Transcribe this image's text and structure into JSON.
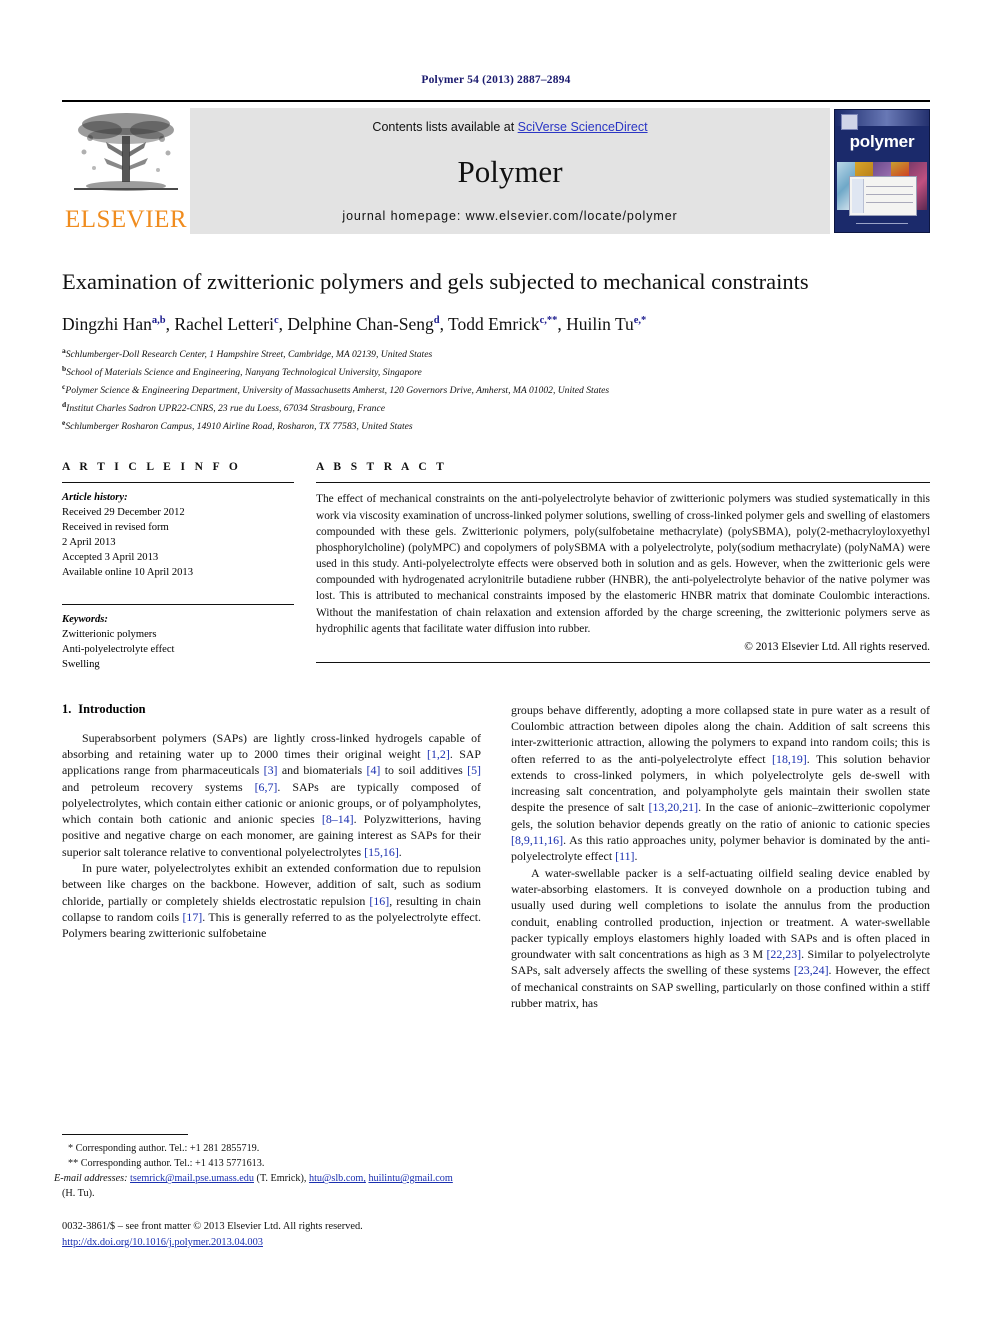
{
  "running_head": "Polymer 54 (2013) 2887–2894",
  "masthead": {
    "publisher_wordmark": "ELSEVIER",
    "contents_prefix": "Contents lists available at ",
    "contents_link": "SciVerse ScienceDirect",
    "journal_title": "Polymer",
    "homepage": "journal homepage: www.elsevier.com/locate/polymer",
    "cover_title": "polymer"
  },
  "article": {
    "title": "Examination of zwitterionic polymers and gels subjected to mechanical constraints",
    "authors_html": "Dingzhi Han<sup>a,b</sup>, Rachel Letteri<sup>c</sup>, Delphine Chan-Seng<sup>d</sup>, Todd Emrick<sup>c,**</sup>, Huilin Tu<sup>e,*</sup>",
    "affiliations": [
      {
        "marker": "a",
        "text": "Schlumberger-Doll Research Center, 1 Hampshire Street, Cambridge, MA 02139, United States"
      },
      {
        "marker": "b",
        "text": "School of Materials Science and Engineering, Nanyang Technological University, Singapore"
      },
      {
        "marker": "c",
        "text": "Polymer Science & Engineering Department, University of Massachusetts Amherst, 120 Governors Drive, Amherst, MA 01002, United States"
      },
      {
        "marker": "d",
        "text": "Institut Charles Sadron UPR22-CNRS, 23 rue du Loess, 67034 Strasbourg, France"
      },
      {
        "marker": "e",
        "text": "Schlumberger Rosharon Campus, 14910 Airline Road, Rosharon, TX 77583, United States"
      }
    ]
  },
  "article_info": {
    "heading": "A R T I C L E  I N F O",
    "history_label": "Article history:",
    "history_lines": [
      "Received 29 December 2012",
      "Received in revised form",
      "2 April 2013",
      "Accepted 3 April 2013",
      "Available online 10 April 2013"
    ],
    "keywords_label": "Keywords:",
    "keywords": [
      "Zwitterionic polymers",
      "Anti-polyelectrolyte effect",
      "Swelling"
    ]
  },
  "abstract": {
    "heading": "A B S T R A C T",
    "text": "The effect of mechanical constraints on the anti-polyelectrolyte behavior of zwitterionic polymers was studied systematically in this work via viscosity examination of uncross-linked polymer solutions, swelling of cross-linked polymer gels and swelling of elastomers compounded with these gels. Zwitterionic polymers, poly(sulfobetaine methacrylate) (polySBMA), poly(2-methacryloyloxyethyl phosphorylcholine) (polyMPC) and copolymers of polySBMA with a polyelectrolyte, poly(sodium methacrylate) (polyNaMA) were used in this study. Anti-polyelectrolyte effects were observed both in solution and as gels. However, when the zwitterionic gels were compounded with hydrogenated acrylonitrile butadiene rubber (HNBR), the anti-polyelectrolyte behavior of the native polymer was lost. This is attributed to mechanical constraints imposed by the elastomeric HNBR matrix that dominate Coulombic interactions. Without the manifestation of chain relaxation and extension afforded by the charge screening, the zwitterionic polymers serve as hydrophilic agents that facilitate water diffusion into rubber.",
    "copyright": "© 2013 Elsevier Ltd. All rights reserved."
  },
  "body": {
    "section_number": "1.",
    "section_title": "Introduction",
    "left_paragraphs_html": [
      "Superabsorbent polymers (SAPs) are lightly cross-linked hydrogels capable of absorbing and retaining water up to 2000 times their original weight <span class=\"ref\">[1,2]</span>. SAP applications range from pharmaceuticals <span class=\"ref\">[3]</span> and biomaterials <span class=\"ref\">[4]</span> to soil additives <span class=\"ref\">[5]</span> and petroleum recovery systems <span class=\"ref\">[6,7]</span>. SAPs are typically composed of polyelectrolytes, which contain either cationic or anionic groups, or of polyampholytes, which contain both cationic and anionic species <span class=\"ref\">[8–14]</span>. Polyzwitterions, having positive and negative charge on each monomer, are gaining interest as SAPs for their superior salt tolerance relative to conventional polyelectrolytes <span class=\"ref\">[15,16]</span>.",
      "In pure water, polyelectrolytes exhibit an extended conformation due to repulsion between like charges on the backbone. However, addition of salt, such as sodium chloride, partially or completely shields electrostatic repulsion <span class=\"ref\">[16]</span>, resulting in chain collapse to random coils <span class=\"ref\">[17]</span>. This is generally referred to as the polyelectrolyte effect. Polymers bearing zwitterionic sulfobetaine"
    ],
    "right_paragraphs_html": [
      "groups behave differently, adopting a more collapsed state in pure water as a result of Coulombic attraction between dipoles along the chain. Addition of salt screens this inter-zwitterionic attraction, allowing the polymers to expand into random coils; this is often referred to as the anti-polyelectrolyte effect <span class=\"ref\">[18,19]</span>. This solution behavior extends to cross-linked polymers, in which polyelectrolyte gels de-swell with increasing salt concentration, and polyampholyte gels maintain their swollen state despite the presence of salt <span class=\"ref\">[13,20,21]</span>. In the case of anionic–zwitterionic copolymer gels, the solution behavior depends greatly on the ratio of anionic to cationic species <span class=\"ref\">[8,9,11,16]</span>. As this ratio approaches unity, polymer behavior is dominated by the anti-polyelectrolyte effect <span class=\"ref\">[11]</span>.",
      "A water-swellable packer is a self-actuating oilfield sealing device enabled by water-absorbing elastomers. It is conveyed downhole on a production tubing and usually used during well completions to isolate the annulus from the production conduit, enabling controlled production, injection or treatment. A water-swellable packer typically employs elastomers highly loaded with SAPs and is often placed in groundwater with salt concentrations as high as 3 M <span class=\"ref\">[22,23]</span>. Similar to polyelectrolyte SAPs, salt adversely affects the swelling of these systems <span class=\"ref\">[23,24]</span>. However, the effect of mechanical constraints on SAP swelling, particularly on those confined within a stiff rubber matrix, has"
    ]
  },
  "footnotes": {
    "corresponding_1": "* Corresponding author. Tel.: +1 281 2855719.",
    "corresponding_2": "** Corresponding author. Tel.: +1 413 5771613.",
    "email_label": "E-mail addresses:",
    "email_1": "tsemrick@mail.pse.umass.edu",
    "email_1_owner": "(T. Emrick),",
    "email_2": "htu@slb.com,",
    "email_3": "huilintu@gmail.com",
    "email_3_owner": "(H. Tu).",
    "imprint": "0032-3861/$ – see front matter © 2013 Elsevier Ltd. All rights reserved.",
    "doi": "http://dx.doi.org/10.1016/j.polymer.2013.04.003"
  },
  "colors": {
    "link": "#1a2fb0",
    "running_head": "#1a1a6e",
    "elsevier_orange": "#F08C1E",
    "masthead_band": "#e3e3e3",
    "cover_navy": "#1b2a6b"
  }
}
